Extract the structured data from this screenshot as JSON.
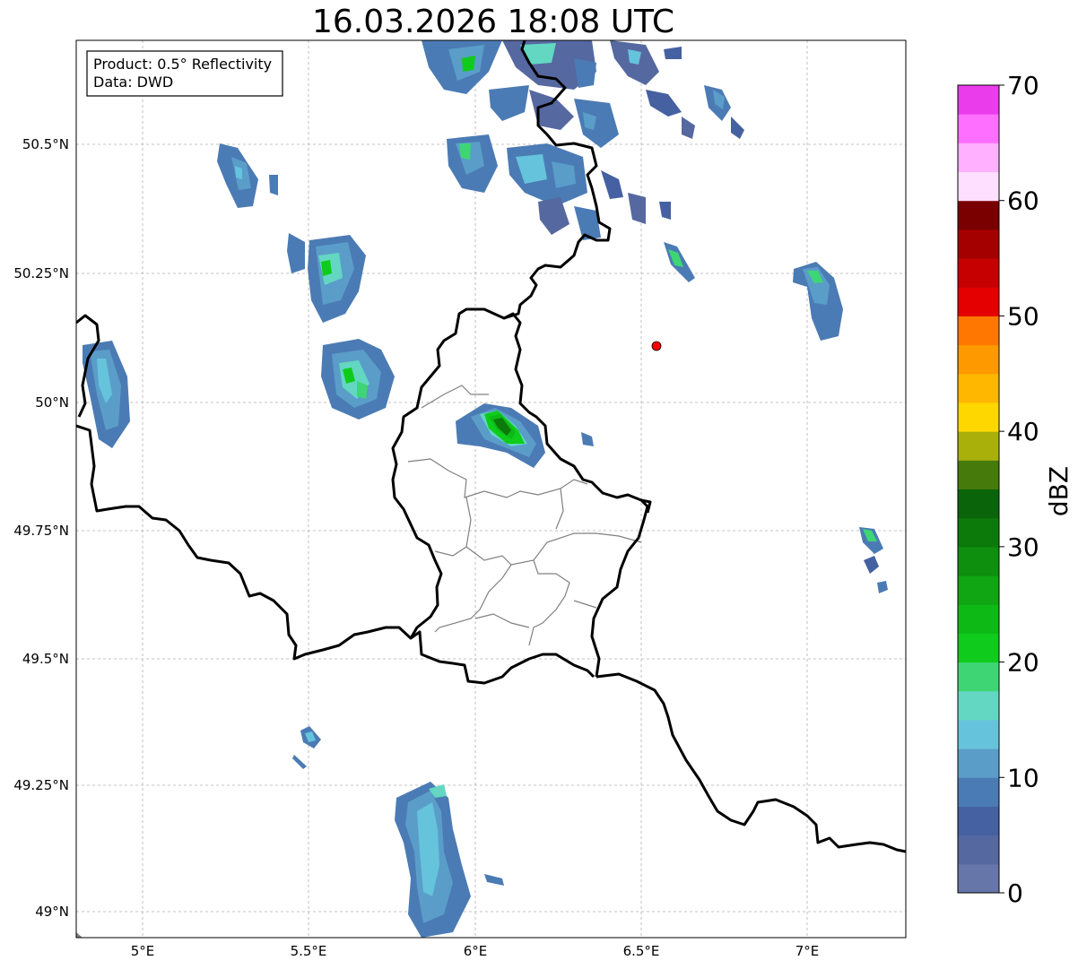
{
  "title": "16.03.2026 18:08 UTC",
  "info_box": {
    "product": "Product: 0.5° Reflectivity",
    "data": "Data: DWD"
  },
  "axes": {
    "lon_ticks": [
      "5°E",
      "5.5°E",
      "6°E",
      "6.5°E",
      "7°E"
    ],
    "lat_ticks": [
      "50.5°N",
      "50.25°N",
      "50°N",
      "49.75°N",
      "49.5°N",
      "49.25°N",
      "49°N"
    ],
    "gridlines": true
  },
  "colorbar": {
    "label": "dBZ",
    "tick_labels": [
      "0",
      "10",
      "20",
      "30",
      "40",
      "50",
      "60",
      "70"
    ],
    "colors": [
      "#6776a8",
      "#5668a0",
      "#4561a1",
      "#4b7bb4",
      "#5a9dc9",
      "#66c3dc",
      "#63d7c1",
      "#3ed674",
      "#0fcb1b",
      "#0db915",
      "#10a512",
      "#0e8f0e",
      "#0b7a0b",
      "#0a650a",
      "#467a0b",
      "#a9b00a",
      "#ffd700",
      "#ffb700",
      "#ff9900",
      "#ff7700",
      "#e40000",
      "#c60000",
      "#a50000",
      "#7a0000",
      "#ffdfff",
      "#ffb0ff",
      "#ff6fff",
      "#ea3ceb"
    ]
  },
  "site_marker": {
    "color": "#ff0000"
  },
  "colors": {
    "border": "#000000",
    "admin": "#808080",
    "grid": "#b0b0b0"
  }
}
